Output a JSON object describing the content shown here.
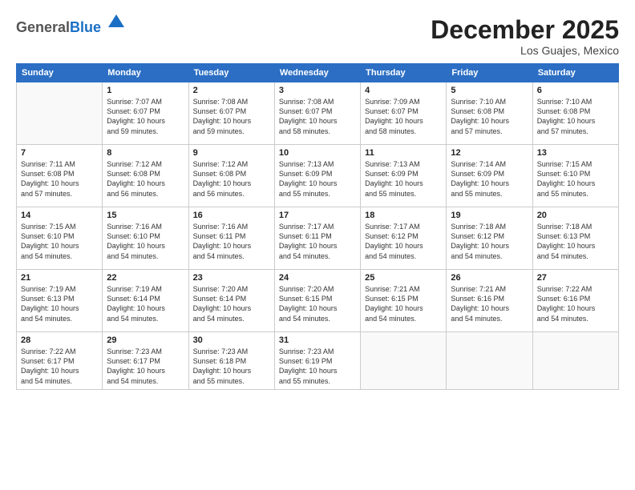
{
  "logo": {
    "general": "General",
    "blue": "Blue"
  },
  "title": "December 2025",
  "subtitle": "Los Guajes, Mexico",
  "days_header": [
    "Sunday",
    "Monday",
    "Tuesday",
    "Wednesday",
    "Thursday",
    "Friday",
    "Saturday"
  ],
  "weeks": [
    [
      {
        "num": "",
        "info": ""
      },
      {
        "num": "1",
        "info": "Sunrise: 7:07 AM\nSunset: 6:07 PM\nDaylight: 10 hours\nand 59 minutes."
      },
      {
        "num": "2",
        "info": "Sunrise: 7:08 AM\nSunset: 6:07 PM\nDaylight: 10 hours\nand 59 minutes."
      },
      {
        "num": "3",
        "info": "Sunrise: 7:08 AM\nSunset: 6:07 PM\nDaylight: 10 hours\nand 58 minutes."
      },
      {
        "num": "4",
        "info": "Sunrise: 7:09 AM\nSunset: 6:07 PM\nDaylight: 10 hours\nand 58 minutes."
      },
      {
        "num": "5",
        "info": "Sunrise: 7:10 AM\nSunset: 6:08 PM\nDaylight: 10 hours\nand 57 minutes."
      },
      {
        "num": "6",
        "info": "Sunrise: 7:10 AM\nSunset: 6:08 PM\nDaylight: 10 hours\nand 57 minutes."
      }
    ],
    [
      {
        "num": "7",
        "info": "Sunrise: 7:11 AM\nSunset: 6:08 PM\nDaylight: 10 hours\nand 57 minutes."
      },
      {
        "num": "8",
        "info": "Sunrise: 7:12 AM\nSunset: 6:08 PM\nDaylight: 10 hours\nand 56 minutes."
      },
      {
        "num": "9",
        "info": "Sunrise: 7:12 AM\nSunset: 6:08 PM\nDaylight: 10 hours\nand 56 minutes."
      },
      {
        "num": "10",
        "info": "Sunrise: 7:13 AM\nSunset: 6:09 PM\nDaylight: 10 hours\nand 55 minutes."
      },
      {
        "num": "11",
        "info": "Sunrise: 7:13 AM\nSunset: 6:09 PM\nDaylight: 10 hours\nand 55 minutes."
      },
      {
        "num": "12",
        "info": "Sunrise: 7:14 AM\nSunset: 6:09 PM\nDaylight: 10 hours\nand 55 minutes."
      },
      {
        "num": "13",
        "info": "Sunrise: 7:15 AM\nSunset: 6:10 PM\nDaylight: 10 hours\nand 55 minutes."
      }
    ],
    [
      {
        "num": "14",
        "info": "Sunrise: 7:15 AM\nSunset: 6:10 PM\nDaylight: 10 hours\nand 54 minutes."
      },
      {
        "num": "15",
        "info": "Sunrise: 7:16 AM\nSunset: 6:10 PM\nDaylight: 10 hours\nand 54 minutes."
      },
      {
        "num": "16",
        "info": "Sunrise: 7:16 AM\nSunset: 6:11 PM\nDaylight: 10 hours\nand 54 minutes."
      },
      {
        "num": "17",
        "info": "Sunrise: 7:17 AM\nSunset: 6:11 PM\nDaylight: 10 hours\nand 54 minutes."
      },
      {
        "num": "18",
        "info": "Sunrise: 7:17 AM\nSunset: 6:12 PM\nDaylight: 10 hours\nand 54 minutes."
      },
      {
        "num": "19",
        "info": "Sunrise: 7:18 AM\nSunset: 6:12 PM\nDaylight: 10 hours\nand 54 minutes."
      },
      {
        "num": "20",
        "info": "Sunrise: 7:18 AM\nSunset: 6:13 PM\nDaylight: 10 hours\nand 54 minutes."
      }
    ],
    [
      {
        "num": "21",
        "info": "Sunrise: 7:19 AM\nSunset: 6:13 PM\nDaylight: 10 hours\nand 54 minutes."
      },
      {
        "num": "22",
        "info": "Sunrise: 7:19 AM\nSunset: 6:14 PM\nDaylight: 10 hours\nand 54 minutes."
      },
      {
        "num": "23",
        "info": "Sunrise: 7:20 AM\nSunset: 6:14 PM\nDaylight: 10 hours\nand 54 minutes."
      },
      {
        "num": "24",
        "info": "Sunrise: 7:20 AM\nSunset: 6:15 PM\nDaylight: 10 hours\nand 54 minutes."
      },
      {
        "num": "25",
        "info": "Sunrise: 7:21 AM\nSunset: 6:15 PM\nDaylight: 10 hours\nand 54 minutes."
      },
      {
        "num": "26",
        "info": "Sunrise: 7:21 AM\nSunset: 6:16 PM\nDaylight: 10 hours\nand 54 minutes."
      },
      {
        "num": "27",
        "info": "Sunrise: 7:22 AM\nSunset: 6:16 PM\nDaylight: 10 hours\nand 54 minutes."
      }
    ],
    [
      {
        "num": "28",
        "info": "Sunrise: 7:22 AM\nSunset: 6:17 PM\nDaylight: 10 hours\nand 54 minutes."
      },
      {
        "num": "29",
        "info": "Sunrise: 7:23 AM\nSunset: 6:17 PM\nDaylight: 10 hours\nand 54 minutes."
      },
      {
        "num": "30",
        "info": "Sunrise: 7:23 AM\nSunset: 6:18 PM\nDaylight: 10 hours\nand 55 minutes."
      },
      {
        "num": "31",
        "info": "Sunrise: 7:23 AM\nSunset: 6:19 PM\nDaylight: 10 hours\nand 55 minutes."
      },
      {
        "num": "",
        "info": ""
      },
      {
        "num": "",
        "info": ""
      },
      {
        "num": "",
        "info": ""
      }
    ]
  ]
}
